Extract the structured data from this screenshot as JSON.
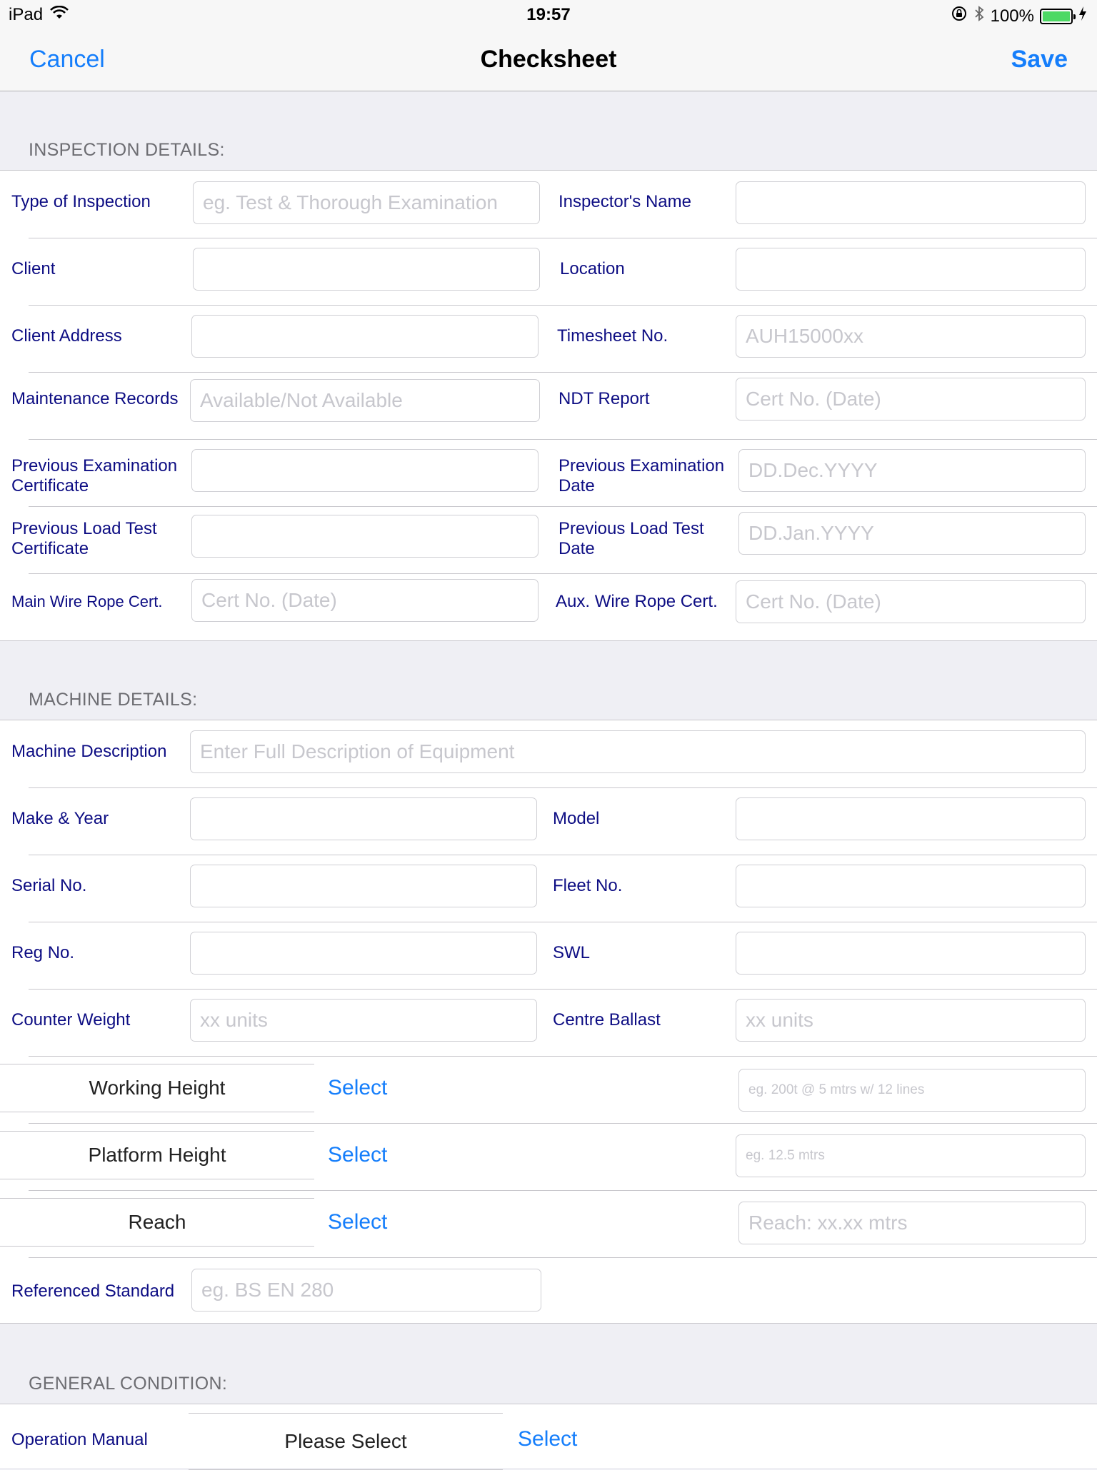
{
  "status_bar": {
    "device": "iPad",
    "time": "19:57",
    "battery": "100%",
    "battery_level": 1.0
  },
  "nav": {
    "cancel": "Cancel",
    "title": "Checksheet",
    "save": "Save"
  },
  "inspection": {
    "header": "INSPECTION DETAILS:",
    "type_label": "Type of Inspection",
    "type_placeholder": "eg. Test & Thorough Examination",
    "inspector_label": "Inspector's Name",
    "client_label": "Client",
    "location_label": "Location",
    "client_address_label": "Client Address",
    "timesheet_label": "Timesheet No.",
    "timesheet_placeholder": "AUH15000xx",
    "maintenance_label": "Maintenance Records",
    "maintenance_placeholder": "Available/Not Available",
    "ndt_label": "NDT Report",
    "ndt_placeholder": "Cert No. (Date)",
    "prev_exam_cert_label_1": "Previous Examination",
    "prev_exam_cert_label_2": "Certificate",
    "prev_exam_date_label_1": "Previous Examination",
    "prev_exam_date_label_2": "Date",
    "prev_exam_date_placeholder": "DD.Dec.YYYY",
    "prev_load_cert_label_1": "Previous Load Test",
    "prev_load_cert_label_2": "Certificate",
    "prev_load_date_label_1": "Previous Load Test",
    "prev_load_date_label_2": "Date",
    "prev_load_date_placeholder": "DD.Jan.YYYY",
    "main_wire_label": "Main Wire Rope Cert.",
    "main_wire_placeholder": "Cert No. (Date)",
    "aux_wire_label": "Aux. Wire Rope Cert.",
    "aux_wire_placeholder": "Cert No. (Date)"
  },
  "machine": {
    "header": "MACHINE DETAILS:",
    "description_label": "Machine Description",
    "description_placeholder": "Enter Full Description of Equipment",
    "make_label": "Make & Year",
    "model_label": "Model",
    "serial_label": "Serial No.",
    "fleet_label": "Fleet No.",
    "reg_label": "Reg No.",
    "swl_label": "SWL",
    "counter_label": "Counter Weight",
    "counter_placeholder": "xx units",
    "ballast_label": "Centre Ballast",
    "ballast_placeholder": "xx units",
    "working_height_label": "Working Height",
    "working_height_select": "Select",
    "working_height_placeholder": "eg. 200t @ 5 mtrs w/ 12 lines",
    "platform_height_label": "Platform Height",
    "platform_height_select": "Select",
    "platform_height_placeholder": "eg. 12.5 mtrs",
    "reach_label": "Reach",
    "reach_select": "Select",
    "reach_placeholder": "Reach: xx.xx mtrs",
    "standard_label": "Referenced Standard",
    "standard_placeholder": "eg. BS EN 280"
  },
  "general": {
    "header": "GENERAL CONDITION:",
    "manual_label": "Operation Manual",
    "manual_picker": "Please Select",
    "manual_select": "Select"
  },
  "colors": {
    "accent": "#157efb",
    "label": "#0d0d83",
    "placeholder": "#c7c7cd",
    "section_header": "#6d6d72",
    "background": "#efeff4"
  }
}
